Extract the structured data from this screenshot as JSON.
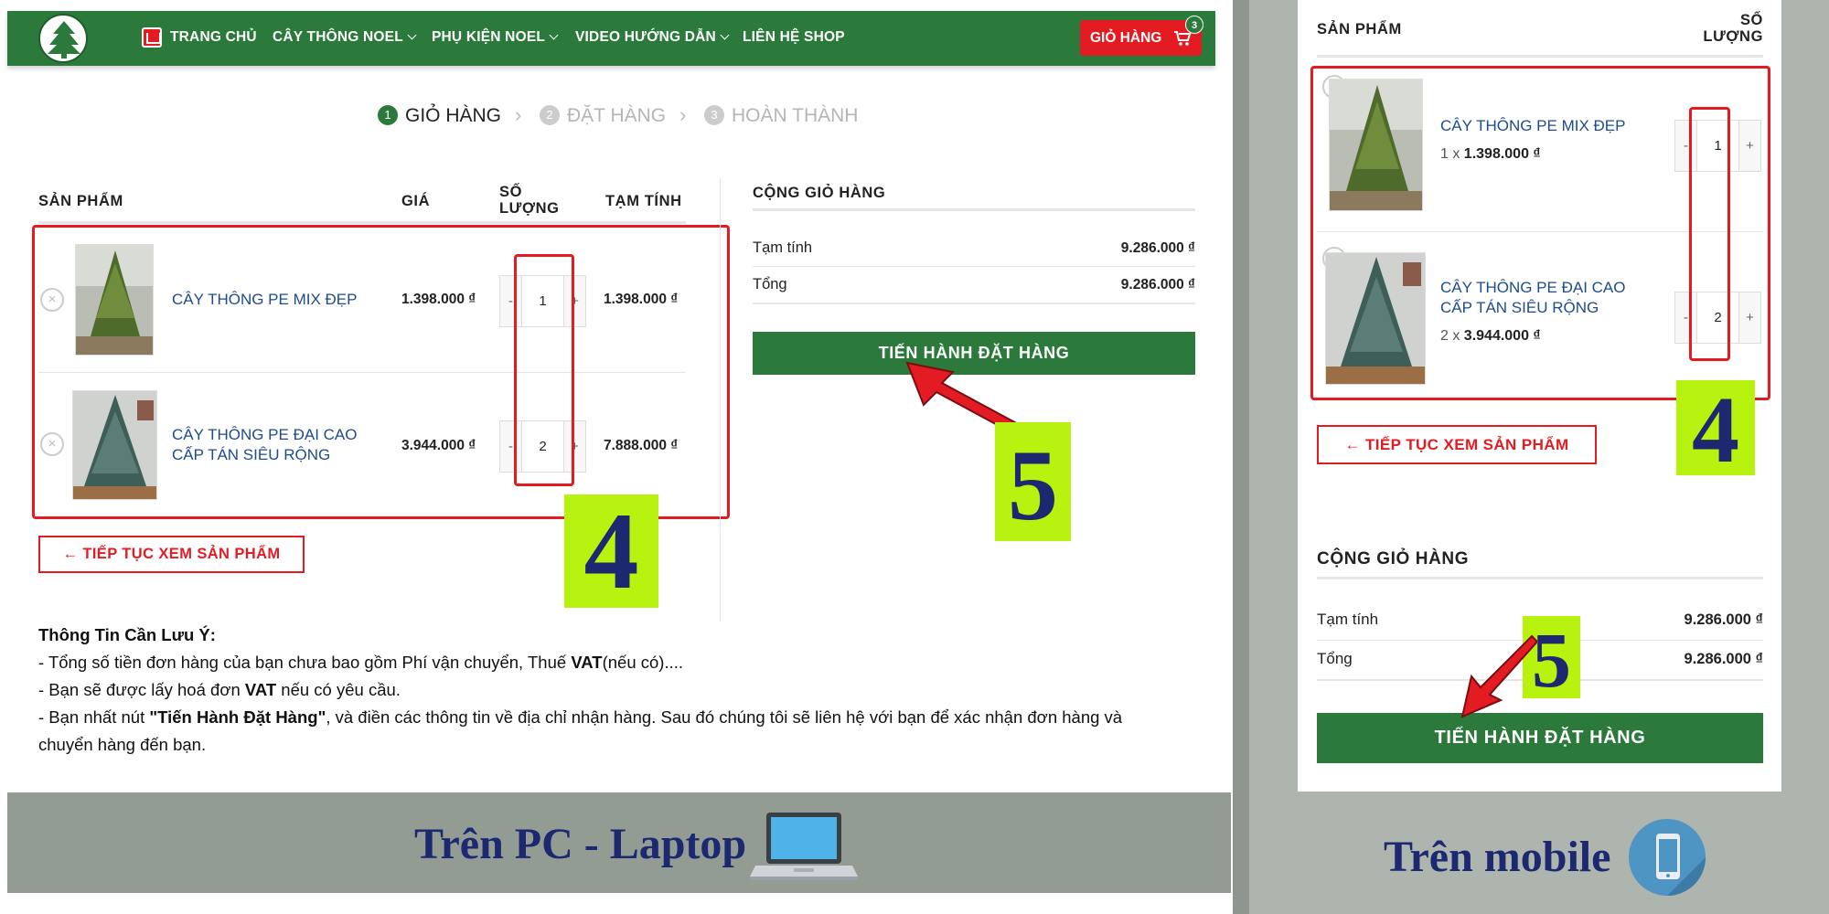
{
  "nav": {
    "items": [
      "Trang chủ",
      "Cây thông noel",
      "Phụ kiện noel",
      "Video hướng dẫn",
      "Liên hệ shop"
    ],
    "cart_label": "Giỏ hàng",
    "cart_count": "3"
  },
  "steps": [
    {
      "num": "1",
      "label": "Giỏ hàng"
    },
    {
      "num": "2",
      "label": "Đặt hàng"
    },
    {
      "num": "3",
      "label": "Hoàn thành"
    }
  ],
  "table": {
    "headers": {
      "product": "Sản phẩm",
      "price": "Giá",
      "qty_1": "Số",
      "qty_2": "lượng",
      "subtotal": "Tạm tính"
    },
    "rows": [
      {
        "name": "CÂY THÔNG PE MIX ĐẸP",
        "price": "1.398.000 ₫",
        "qty": "1",
        "subtotal": "1.398.000 ₫",
        "mobile_line": "1 x",
        "mobile_price": "1.398.000 ₫"
      },
      {
        "name_1": "CÂY THÔNG PE ĐẠI CAO",
        "name_2": "CẤP TÁN SIÊU RỘNG",
        "price": "3.944.000 ₫",
        "qty": "2",
        "subtotal": "7.888.000 ₫",
        "mobile_line": "2 x",
        "mobile_price": "3.944.000 ₫"
      }
    ],
    "qty_minus": "-",
    "qty_plus": "+",
    "remove_glyph": "×"
  },
  "totals": {
    "title": "Cộng giỏ hàng",
    "subtotal_label": "Tạm tính",
    "subtotal_value": "9.286.000 ₫",
    "total_label": "Tổng",
    "total_value": "9.286.000 ₫",
    "checkout_label": "Tiến hành đặt hàng"
  },
  "continue_label": "← Tiếp tục xem sản phẩm",
  "notes": {
    "title": "Thông Tin Cần Lưu Ý:",
    "line1_a": "- Tổng số tiền đơn hàng của bạn chưa bao gồm Phí vận chuyển, Thuế ",
    "line1_b": "VAT",
    "line1_c": "(nếu có)....",
    "line2_a": "- Bạn sẽ được lấy hoá đơn ",
    "line2_b": "VAT",
    "line2_c": " nếu có yêu cầu.",
    "line3_a": "- Bạn nhất nút ",
    "line3_b": "\"Tiến Hành Đặt Hàng\"",
    "line3_c": ", và điền các thông tin về địa chỉ nhận hàng. Sau đó chúng tôi sẽ liên hệ với bạn để xác nhận đơn hàng và",
    "line4": "chuyển hàng đến bạn."
  },
  "annotations": {
    "step4": "4",
    "step5": "5"
  },
  "banners": {
    "pc": "Trên PC - Laptop",
    "mobile": "Trên mobile"
  },
  "colors": {
    "brand_green": "#2b7a3b",
    "cart_red": "#e31b23",
    "link_blue": "#1d4b8c",
    "badge_lime": "#b8f20f",
    "badge_text": "#1c2870",
    "banner_gray": "#939c93"
  },
  "icons": [
    "tree-logo-icon",
    "home-icon",
    "chevron-down-icon",
    "cart-icon",
    "close-icon",
    "laptop-icon",
    "phone-icon",
    "arrow-icon"
  ]
}
